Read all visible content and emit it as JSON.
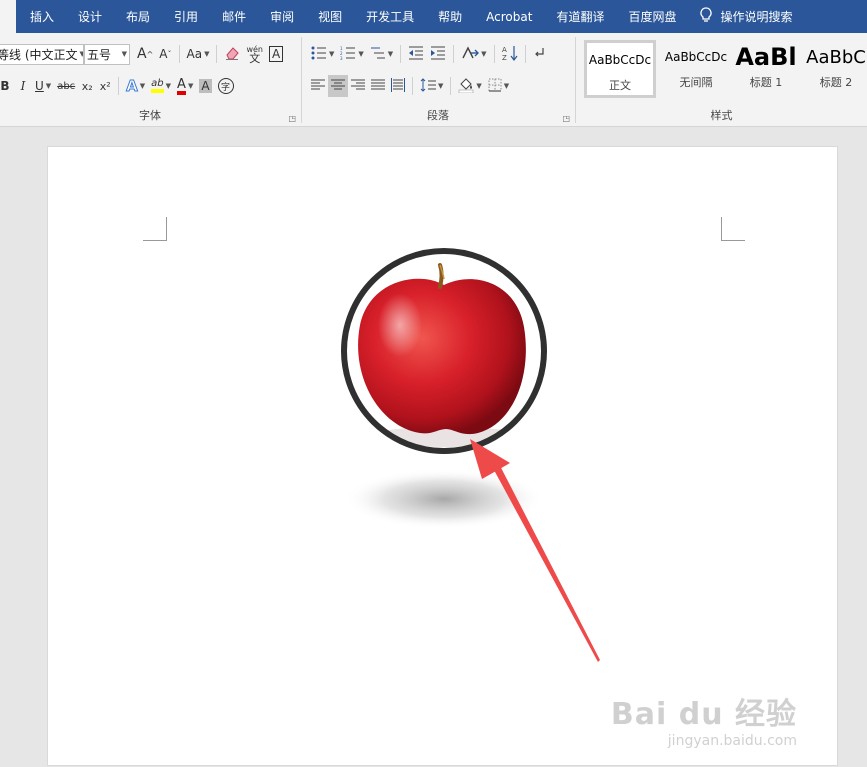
{
  "tabs": [
    "插入",
    "设计",
    "布局",
    "引用",
    "邮件",
    "审阅",
    "视图",
    "开发工具",
    "帮助",
    "Acrobat",
    "有道翻译",
    "百度网盘"
  ],
  "tell_me": "操作说明搜索",
  "font": {
    "name": "等线 (中文正文",
    "size": "五号",
    "grow_label": "A",
    "shrink_label": "A",
    "case_label": "Aa",
    "phonetic_top": "wén",
    "phonetic_bottom": "文",
    "border_label": "A",
    "bold": "B",
    "italic": "I",
    "underline": "U",
    "strike": "abc",
    "subscript": "x₂",
    "superscript": "x²",
    "effects": "A",
    "highlight": "ab",
    "font_color": "A",
    "shading": "A",
    "enclose": "字",
    "group_label": "字体"
  },
  "paragraph": {
    "group_label": "段落"
  },
  "styles": {
    "group_label": "样式",
    "items": [
      {
        "sample": "AaBbCcDc",
        "name": "正文"
      },
      {
        "sample": "AaBbCcDc",
        "name": "无间隔"
      },
      {
        "sample": "AaBl",
        "name": "标题 1"
      },
      {
        "sample": "AaBbC",
        "name": "标题 2"
      }
    ]
  },
  "watermark": {
    "main": "Bai du 经验",
    "sub": "jingyan.baidu.com"
  },
  "colors": {
    "accent": "#2b579a",
    "arrow": "#ef4a4a",
    "highlight": "#ffff00",
    "font_color": "#e00000"
  }
}
